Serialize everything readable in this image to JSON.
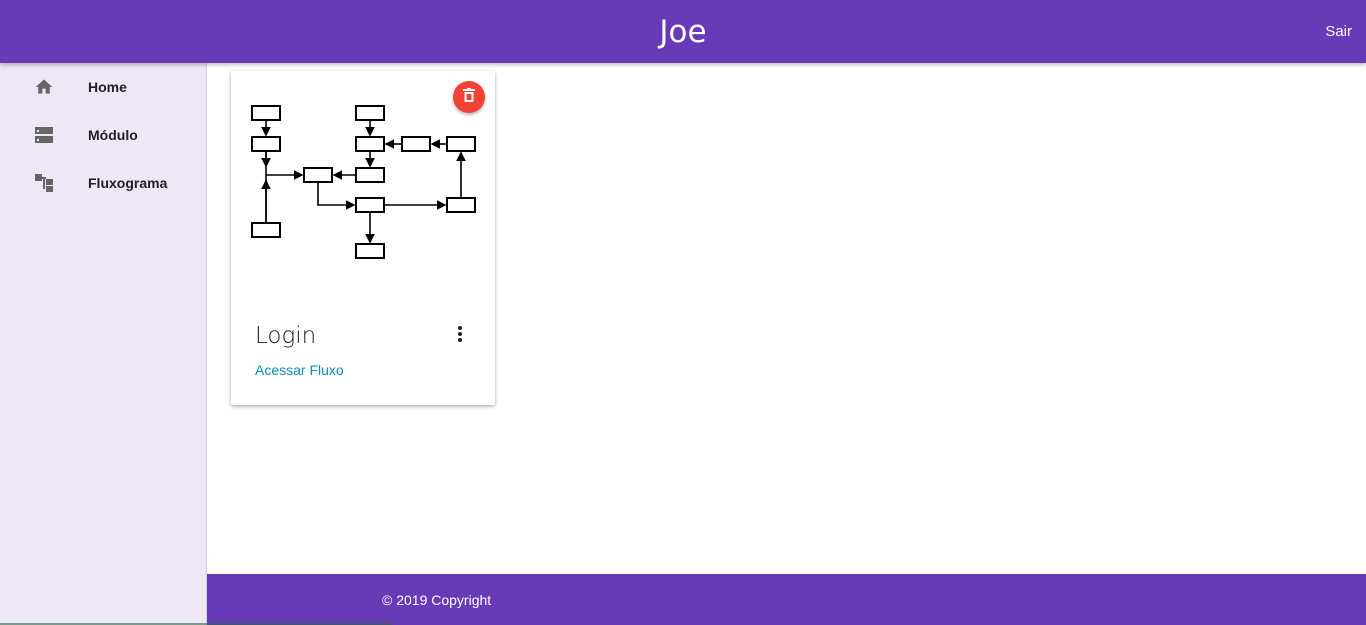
{
  "header": {
    "title": "Joe",
    "logout_label": "Sair"
  },
  "sidebar": {
    "items": [
      {
        "label": "Home",
        "icon": "home-icon"
      },
      {
        "label": "Módulo",
        "icon": "module-icon"
      },
      {
        "label": "Fluxograma",
        "icon": "flowchart-icon"
      }
    ]
  },
  "card": {
    "title": "Login",
    "link_label": "Acessar Fluxo",
    "image": "flowchart-diagram",
    "delete_icon": "trash-icon",
    "menu_icon": "more-vert-icon"
  },
  "footer": {
    "copyright": "© 2019 Copyright"
  },
  "colors": {
    "primary": "#673ab7",
    "sidebar_bg": "#ede7f6",
    "danger": "#f44336",
    "link": "#0a8fb5"
  }
}
